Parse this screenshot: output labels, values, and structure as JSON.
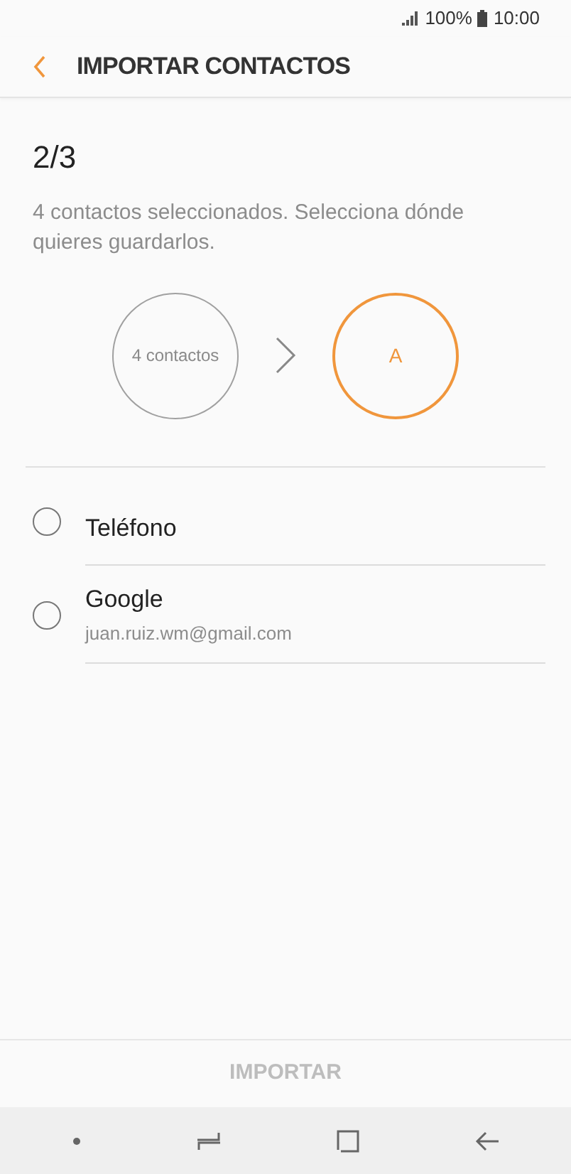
{
  "status_bar": {
    "battery": "100%",
    "time": "10:00"
  },
  "header": {
    "title": "IMPORTAR CONTACTOS"
  },
  "step": "2/3",
  "description": "4 contactos seleccionados. Selecciona dónde quieres guardarlos.",
  "flow": {
    "source": "4 contactos",
    "target": "A"
  },
  "options": [
    {
      "label": "Teléfono",
      "selected": false
    },
    {
      "label": "Google",
      "subtitle": "juan.ruiz.wm@gmail.com",
      "selected": false
    }
  ],
  "import_button": {
    "label": "IMPORTAR",
    "disabled": true
  }
}
